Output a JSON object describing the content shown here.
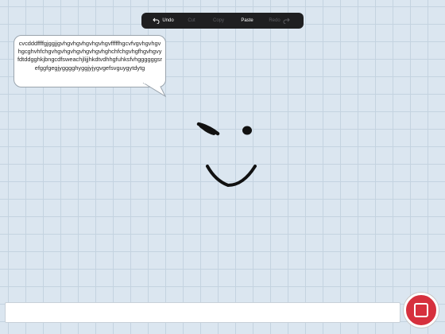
{
  "toolbar": {
    "undo_label": "Undo",
    "cut_label": "Cut",
    "copy_label": "Copy",
    "paste_label": "Paste",
    "redo_label": "Redo",
    "undo_icon": "undo-arrow-icon",
    "redo_icon": "redo-arrow-icon"
  },
  "bubble": {
    "text": "cvcdddffffgjggjjgvhgvhgvhgvhgvhgvfffffhgcvfvgvhgvhgvhgcghvhfchgvhgvhgvhgvhgvhgvhghchfchgvhgfhgvhgvyfdtddgghkjbngcdfsweachjlijjhkdtvdhhgfuhksfvhggggggsrefggfgegjygggghyggjyjygvgefsvguygytdytg"
  },
  "answer": {
    "value": "",
    "placeholder": ""
  },
  "submit": {
    "icon": "checkmark-box-icon"
  },
  "colors": {
    "canvas": "#dbe6f0",
    "grid": "#c4d3e0",
    "toolbar": "#1f1f21",
    "submit": "#d6303d"
  }
}
